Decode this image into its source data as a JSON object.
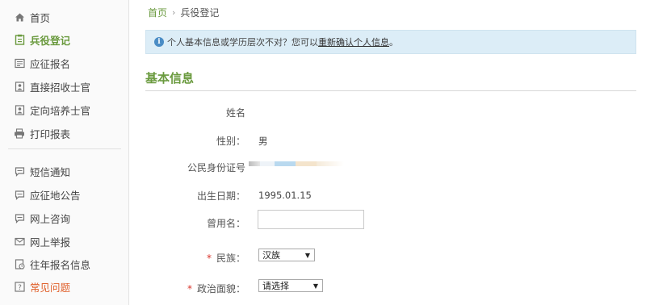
{
  "sidebar": {
    "items": [
      {
        "label": "首页",
        "icon": "home-icon"
      },
      {
        "label": "兵役登记",
        "icon": "clipboard-icon"
      },
      {
        "label": "应征报名",
        "icon": "form-icon"
      },
      {
        "label": "直接招收士官",
        "icon": "id-card-icon"
      },
      {
        "label": "定向培养士官",
        "icon": "id-card-icon"
      },
      {
        "label": "打印报表",
        "icon": "printer-icon"
      },
      {
        "label": "短信通知",
        "icon": "chat-icon"
      },
      {
        "label": "应征地公告",
        "icon": "chat-icon"
      },
      {
        "label": "网上咨询",
        "icon": "chat-icon"
      },
      {
        "label": "网上举报",
        "icon": "mail-icon"
      },
      {
        "label": "往年报名信息",
        "icon": "history-icon"
      },
      {
        "label": "常见问题",
        "icon": "question-icon"
      }
    ],
    "active_index": 1,
    "accent_color": "#6a9a3e",
    "warn_color": "#e0602b"
  },
  "breadcrumb": {
    "home": "首页",
    "separator": "›",
    "current": "兵役登记"
  },
  "notice": {
    "icon": "info-icon",
    "text": "个人基本信息或学历层次不对？您可以",
    "link": "重新确认个人信息",
    "suffix": "。"
  },
  "section": {
    "title": "基本信息"
  },
  "form": {
    "name_label": "姓名",
    "gender_label": "性别：",
    "gender_value": "男",
    "id_label": "公民身份证号",
    "birth_label": "出生日期：",
    "birth_value": "1995.01.15",
    "alias_label": "曾用名：",
    "alias_value": "",
    "ethnicity_label": "民族：",
    "ethnicity_value": "汉族",
    "political_label": "政治面貌：",
    "political_value": "请选择",
    "required_mark": "*"
  }
}
